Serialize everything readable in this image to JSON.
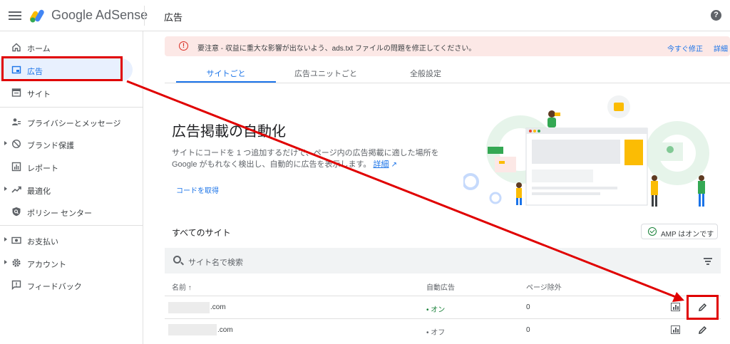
{
  "header": {
    "brand": "Google AdSense",
    "page_title": "広告",
    "help": "?"
  },
  "sidebar": {
    "items": [
      {
        "label": "ホーム",
        "icon": "home-icon"
      },
      {
        "label": "広告",
        "icon": "ads-icon",
        "active": true
      },
      {
        "label": "サイト",
        "icon": "sites-icon"
      },
      {
        "label": "プライバシーとメッセージ",
        "icon": "privacy-icon"
      },
      {
        "label": "ブランド保護",
        "icon": "block-icon"
      },
      {
        "label": "レポート",
        "icon": "reports-icon"
      },
      {
        "label": "最適化",
        "icon": "trending-icon"
      },
      {
        "label": "ポリシー センター",
        "icon": "policy-icon"
      },
      {
        "label": "お支払い",
        "icon": "payments-icon"
      },
      {
        "label": "アカウント",
        "icon": "settings-icon"
      },
      {
        "label": "フィードバック",
        "icon": "feedback-icon"
      }
    ]
  },
  "alert": {
    "text": "要注意 - 収益に重大な影響が出ないよう、ads.txt ファイルの問題を修正してください。",
    "fix_now": "今すぐ修正",
    "details": "詳細"
  },
  "tabs": [
    {
      "label": "サイトごと",
      "active": true
    },
    {
      "label": "広告ユニットごと"
    },
    {
      "label": "全般設定"
    }
  ],
  "hero": {
    "title": "広告掲載の自動化",
    "desc": "サイトにコードを 1 つ追加するだけで、ページ内の広告掲載に適した場所を Google がもれなく検出し、自動的に広告を表示します。",
    "learn_more": "詳細",
    "get_code": "コードを取得"
  },
  "sites": {
    "heading": "すべてのサイト",
    "amp_chip": "AMP はオンです",
    "search_placeholder": "サイト名で検索",
    "columns": {
      "name": "名前 ↑",
      "auto_ads": "自動広告",
      "page_excl": "ページ除外"
    },
    "rows": [
      {
        "name": ".com",
        "auto_ads": "• オン",
        "page_excl": "0"
      },
      {
        "name": ".com",
        "auto_ads": "• オフ",
        "page_excl": "0"
      }
    ]
  },
  "colors": {
    "accent": "#1a73e8",
    "highlight": "#e00000",
    "alert_bg": "#fce8e6",
    "on": "#188038"
  }
}
